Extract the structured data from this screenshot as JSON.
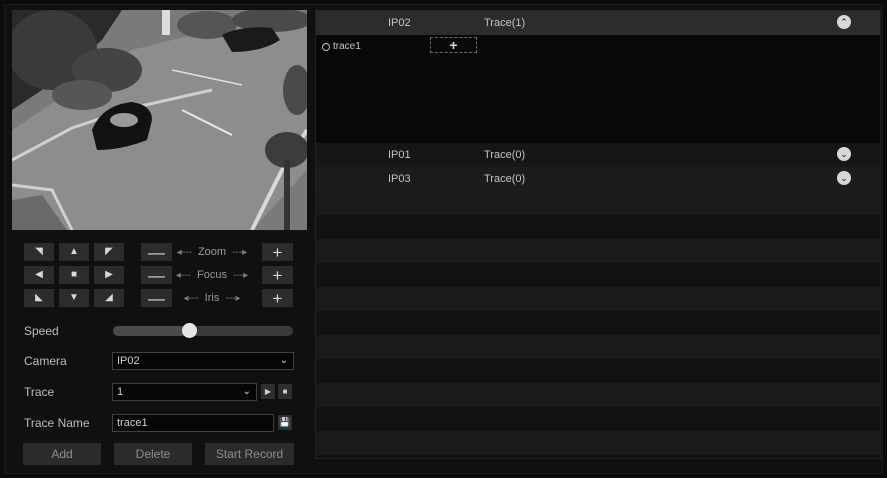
{
  "ptz": {
    "up_left": "◥",
    "up": "▲",
    "up_right": "◤",
    "left": "◀",
    "stop": "■",
    "right": "▶",
    "down_left": "◣",
    "down": "▼",
    "down_right": "◢",
    "minus": "—",
    "plus": "+",
    "zoom_label": "Zoom",
    "focus_label": "Focus",
    "iris_label": "Iris",
    "arrow_in": "◂---",
    "arrow_out": "---▸"
  },
  "form": {
    "speed_label": "Speed",
    "speed_level": 0.42,
    "camera_label": "Camera",
    "camera_value": "IP02",
    "trace_label": "Trace",
    "trace_value": "1",
    "trace_name_label": "Trace Name",
    "trace_name_value": "trace1",
    "play_icon": "▶",
    "stop_icon": "■",
    "save_icon": "💾",
    "dropdown_icon": "⌄"
  },
  "actions": {
    "add": "Add",
    "delete": "Delete",
    "start_record": "Start Record"
  },
  "trace_panel": {
    "rows": [
      {
        "camera": "IP02",
        "trace": "Trace(1)",
        "expanded": true,
        "toggle_icon": "⌃"
      },
      {
        "camera": "IP01",
        "trace": "Trace(0)",
        "expanded": false,
        "toggle_icon": "⌄"
      },
      {
        "camera": "IP03",
        "trace": "Trace(0)",
        "expanded": false,
        "toggle_icon": "⌄"
      }
    ],
    "expanded_items": [
      "trace1"
    ],
    "add_icon": "+"
  }
}
